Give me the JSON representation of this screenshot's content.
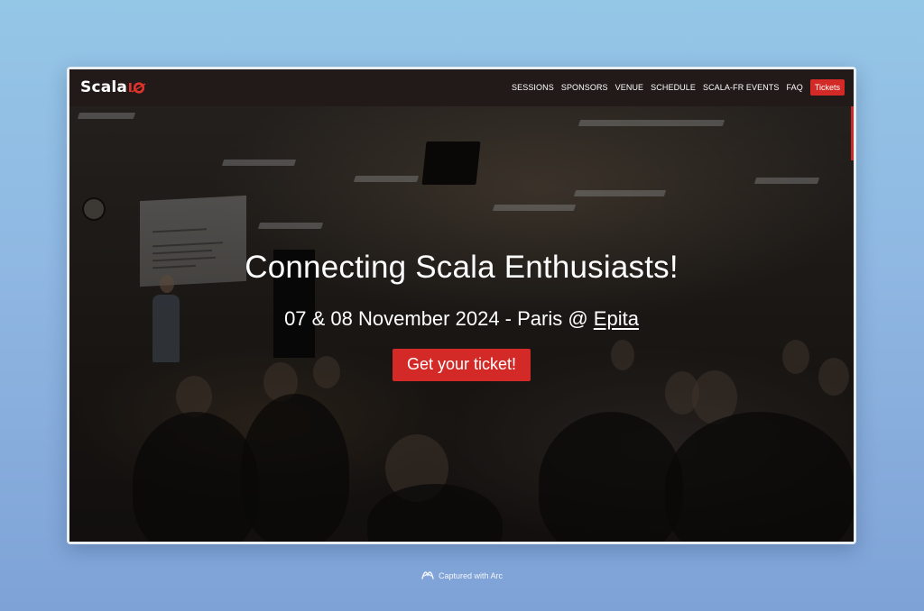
{
  "navbar": {
    "logo_text": "Scala",
    "links": [
      {
        "label": "SESSIONS"
      },
      {
        "label": "SPONSORS"
      },
      {
        "label": "VENUE"
      },
      {
        "label": "SCHEDULE"
      },
      {
        "label": "SCALA-FR EVENTS"
      },
      {
        "label": "FAQ"
      }
    ],
    "tickets_label": "Tickets"
  },
  "hero": {
    "title": "Connecting Scala Enthusiasts!",
    "subtitle_prefix": "07 & 08 November 2024 - Paris @ ",
    "venue_link": "Epita",
    "cta_label": "Get your ticket!"
  },
  "footer": {
    "caption": "Captured with Arc"
  },
  "colors": {
    "accent": "#d42a27",
    "navbar_bg": "#211a18",
    "background_top": "#94c6e6",
    "background_bottom": "#7ea2d6"
  },
  "icons": {
    "logo_mark": "scala-io-mark-icon",
    "caption_icon": "arc-browser-icon"
  }
}
